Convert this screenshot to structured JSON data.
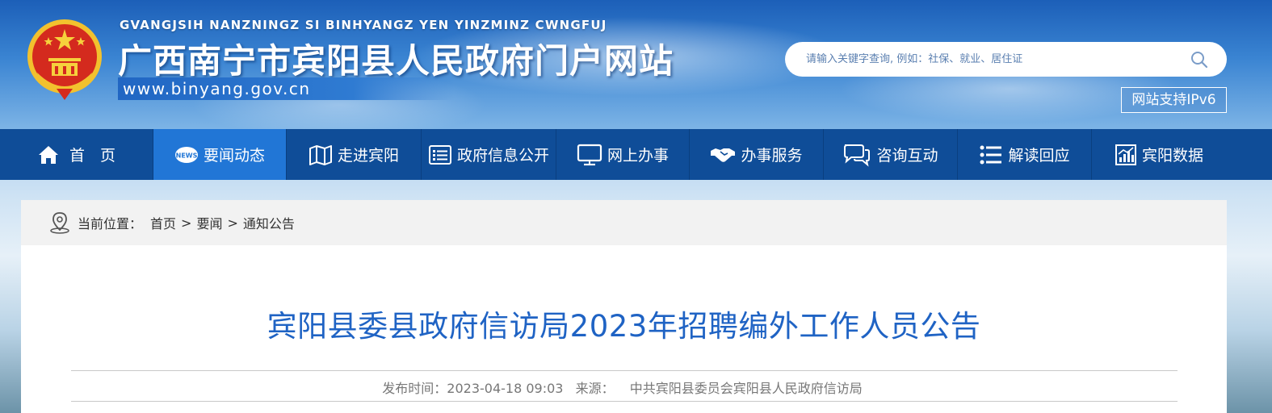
{
  "header": {
    "pinyin": "GVANGJSIH NANZNINGZ SI BINHYANGZ YEN YINZMINZ CWNGFUJ",
    "site_title": "广西南宁市宾阳县人民政府门户网站",
    "site_url": "www.binyang.gov.cn",
    "search_placeholder": "请输入关键字查询, 例如：社保、就业、居住证",
    "ipv6_label": "网站支持IPv6"
  },
  "nav": {
    "items": [
      {
        "label": "首　页",
        "icon": "home-icon"
      },
      {
        "label": "要闻动态",
        "icon": "news-icon",
        "active": true
      },
      {
        "label": "走进宾阳",
        "icon": "map-icon"
      },
      {
        "label": "政府信息公开",
        "icon": "list-doc-icon"
      },
      {
        "label": "网上办事",
        "icon": "monitor-icon"
      },
      {
        "label": "办事服务",
        "icon": "handshake-icon"
      },
      {
        "label": "咨询互动",
        "icon": "chat-icon"
      },
      {
        "label": "解读回应",
        "icon": "bullet-list-icon"
      },
      {
        "label": "宾阳数据",
        "icon": "bar-chart-icon"
      }
    ]
  },
  "breadcrumb": {
    "prefix": "当前位置：",
    "items": [
      "首页",
      "要闻",
      "通知公告"
    ],
    "separator": ">"
  },
  "article": {
    "title": "宾阳县委县政府信访局2023年招聘编外工作人员公告",
    "publish_label": "发布时间：",
    "publish_time": "2023-04-18 09:03",
    "source_label": "来源：",
    "source": "中共宾阳县委员会宾阳县人民政府信访局"
  },
  "colors": {
    "nav_bg": "#0f4d98",
    "nav_active": "#2176d6",
    "title_blue": "#1f63c4"
  }
}
